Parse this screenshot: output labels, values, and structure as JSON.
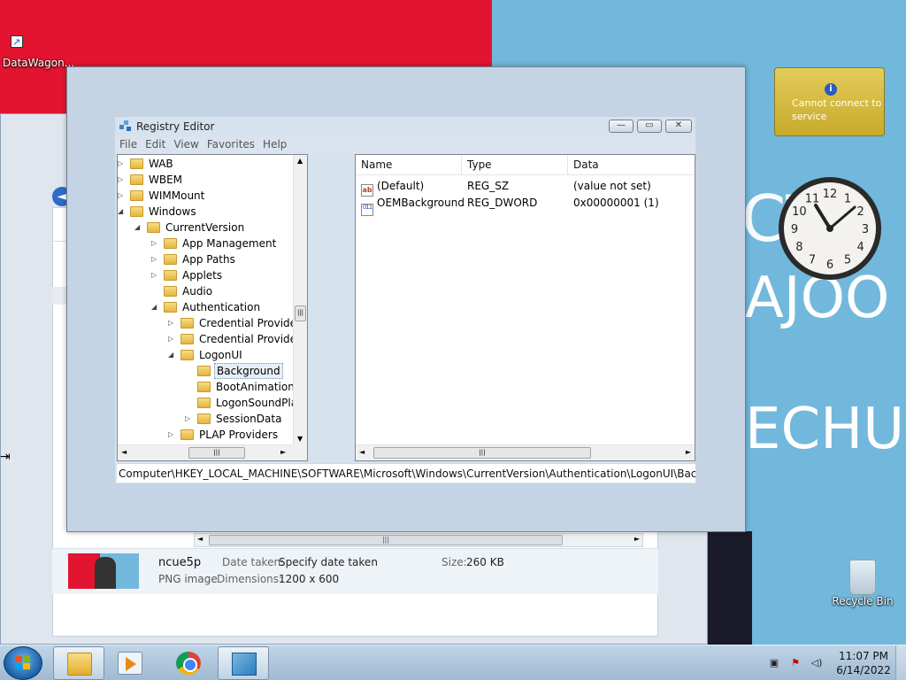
{
  "desktop": {
    "icons": [
      {
        "label": "DataWagon..."
      },
      {
        "label": "Recycle Bin"
      }
    ],
    "wallpaper_text": [
      "CT",
      "AJOO",
      "ECHUD"
    ],
    "colors": {
      "red": "#e2142f",
      "blue": "#72b8dc"
    }
  },
  "weather_gadget": {
    "info_glyph": "i",
    "message": "Cannot connect to service"
  },
  "clock_gadget": {
    "numerals": [
      "12",
      "1",
      "2",
      "3",
      "4",
      "5",
      "6",
      "7",
      "8",
      "9",
      "10",
      "11"
    ]
  },
  "explorer": {
    "back_glyph": "◄",
    "details": {
      "name": "ncue5p",
      "type": "PNG image",
      "date_taken_label": "Date taken:",
      "date_taken_value": "Specify date taken",
      "dimensions_label": "Dimensions:",
      "dimensions_value": "1200 x 600",
      "size_label": "Size:",
      "size_value": "260 KB"
    }
  },
  "regedit": {
    "title": "Registry Editor",
    "buttons": {
      "minimize": "—",
      "maximize": "▭",
      "close": "✕"
    },
    "menu": [
      "File",
      "Edit",
      "View",
      "Favorites",
      "Help"
    ],
    "tree": [
      {
        "label": "WAB",
        "exp": "▷"
      },
      {
        "label": "WBEM",
        "exp": "▷"
      },
      {
        "label": "WIMMount",
        "exp": "▷"
      },
      {
        "label": "Windows",
        "exp": "◢"
      },
      {
        "label": "CurrentVersion",
        "exp": "◢"
      },
      {
        "label": "App Management",
        "exp": "▷"
      },
      {
        "label": "App Paths",
        "exp": "▷"
      },
      {
        "label": "Applets",
        "exp": "▷"
      },
      {
        "label": "Audio",
        "exp": ""
      },
      {
        "label": "Authentication",
        "exp": "◢"
      },
      {
        "label": "Credential Provider F",
        "exp": "▷"
      },
      {
        "label": "Credential Providers",
        "exp": "▷"
      },
      {
        "label": "LogonUI",
        "exp": "◢"
      },
      {
        "label": "Background",
        "exp": ""
      },
      {
        "label": "BootAnimation",
        "exp": ""
      },
      {
        "label": "LogonSoundPlay",
        "exp": ""
      },
      {
        "label": "SessionData",
        "exp": "▷"
      },
      {
        "label": "PLAP Providers",
        "exp": "▷"
      }
    ],
    "selected_key": "Background",
    "columns": {
      "name": "Name",
      "type": "Type",
      "data": "Data"
    },
    "values": [
      {
        "icon": "ab",
        "name": "(Default)",
        "type": "REG_SZ",
        "data": "(value not set)"
      },
      {
        "icon": "011",
        "name": "OEMBackground",
        "type": "REG_DWORD",
        "data": "0x00000001 (1)"
      }
    ],
    "status_path": "Computer\\HKEY_LOCAL_MACHINE\\SOFTWARE\\Microsoft\\Windows\\CurrentVersion\\Authentication\\LogonUI\\Background",
    "scroll_glyphs": {
      "up": "▲",
      "down": "▼",
      "left": "◄",
      "right": "►",
      "grip": "|||"
    }
  },
  "taskbar": {
    "apps": [
      "Windows Explorer",
      "Windows Media Player",
      "Google Chrome",
      "Registry Editor"
    ],
    "time": "11:07 PM",
    "date": "6/14/2022",
    "tray_glyphs": {
      "network": "▣",
      "action_center": "⚑",
      "volume": "◁)"
    }
  }
}
